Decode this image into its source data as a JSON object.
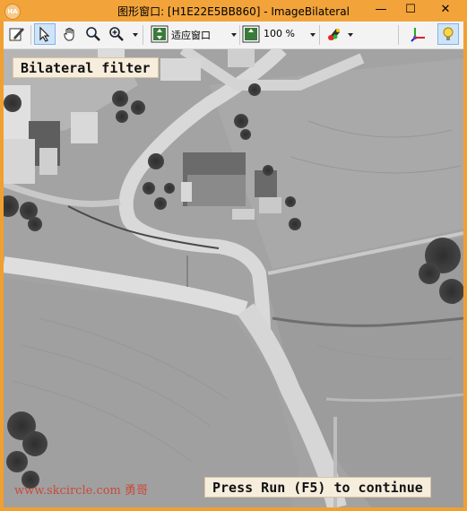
{
  "window": {
    "title": "图形窗口: [H1E22E5BB860] - ImageBilateral",
    "app_icon_text": "HA",
    "minimize": "—",
    "maximize": "☐",
    "close": "✕"
  },
  "toolbar": {
    "fit_combo_value": "适应窗口",
    "zoom_combo_value": "100 %",
    "icons": [
      "edit-icon",
      "pointer-icon",
      "hand-icon",
      "magnifier-icon",
      "zoom-in-icon",
      "fit-window-icon",
      "zoom-percent-icon",
      "color-set-icon",
      "axes-icon",
      "lightbulb-icon"
    ]
  },
  "image": {
    "top_label": "Bilateral filter",
    "bottom_label": "Press Run (F5) to continue",
    "watermark": "www.skcircle.com 勇哥"
  },
  "colors": {
    "title_bar": "#f2a43a",
    "label_bg": "#f7eddd",
    "watermark": "#d13c2a"
  }
}
